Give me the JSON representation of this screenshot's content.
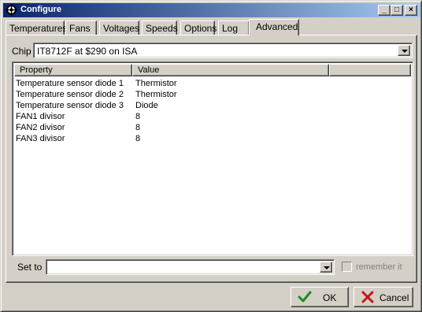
{
  "window": {
    "title": "Configure",
    "icon": "gear-icon",
    "controls": {
      "minimize": "_",
      "maximize": "□",
      "close": "×"
    }
  },
  "tabs": [
    {
      "label": "Temperatures",
      "active": false
    },
    {
      "label": "Fans",
      "active": false
    },
    {
      "label": "Voltages",
      "active": false
    },
    {
      "label": "Speeds",
      "active": false
    },
    {
      "label": "Options",
      "active": false
    },
    {
      "label": "Log",
      "active": false
    },
    {
      "label": "Advanced",
      "active": true
    }
  ],
  "chip": {
    "label": "Chip",
    "value": "IT8712F at $290 on ISA"
  },
  "table": {
    "columns": [
      "Property",
      "Value"
    ],
    "rows": [
      {
        "property": "Temperature sensor diode 1",
        "value": "Thermistor"
      },
      {
        "property": "Temperature sensor diode 2",
        "value": "Thermistor"
      },
      {
        "property": "Temperature sensor diode 3",
        "value": "Diode"
      },
      {
        "property": "FAN1 divisor",
        "value": "8"
      },
      {
        "property": "FAN2 divisor",
        "value": "8"
      },
      {
        "property": "FAN3 divisor",
        "value": "8"
      }
    ]
  },
  "set_to": {
    "label": "Set to",
    "value": ""
  },
  "remember": {
    "label": "remember it",
    "checked": false,
    "enabled": false
  },
  "buttons": {
    "ok": "OK",
    "cancel": "Cancel"
  },
  "colors": {
    "title_start": "#0a246a",
    "title_end": "#a6caf0",
    "face": "#d4d0c8",
    "ok_check": "#1e8c1e",
    "cancel_x": "#c81414"
  }
}
